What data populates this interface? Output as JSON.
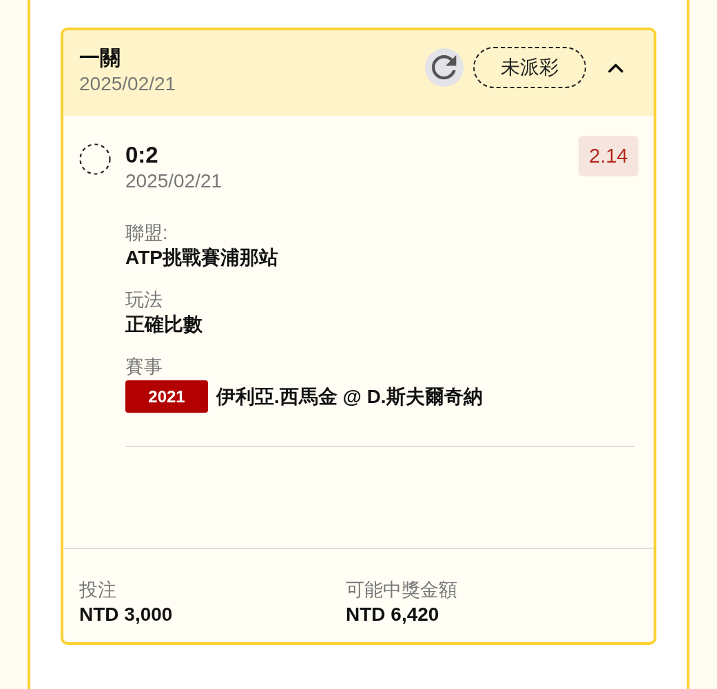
{
  "bet": {
    "title": "一關",
    "date": "2025/02/21",
    "status": "未派彩",
    "expanded": true
  },
  "selections": [
    {
      "settled": false,
      "score": "0:2",
      "date": "2025/02/21",
      "odds": "2.14",
      "details": [
        {
          "kind": "text",
          "label": "聯盟:",
          "value": "ATP挑戰賽浦那站"
        },
        {
          "kind": "text",
          "label": "玩法",
          "value": "正確比數"
        },
        {
          "kind": "event",
          "label": "賽事",
          "code": "2021",
          "value": "伊利亞.西馬金 @ D.斯夫爾奇納"
        }
      ]
    }
  ],
  "summary": [
    {
      "label": "投注",
      "value": "NTD 3,000"
    },
    {
      "label": "可能中獎金額",
      "value": "NTD 6,420"
    }
  ]
}
